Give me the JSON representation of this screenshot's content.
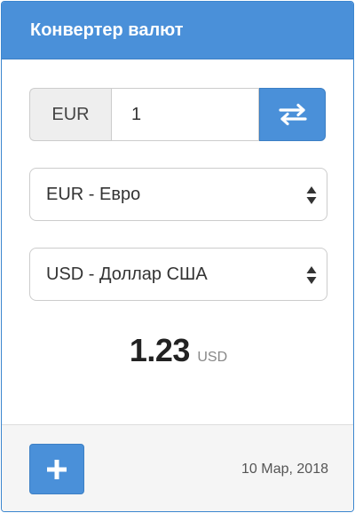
{
  "header": {
    "title": "Конвертер валют"
  },
  "converter": {
    "base_currency_code": "EUR",
    "amount": "1",
    "from_select": {
      "selected": "EUR - Евро"
    },
    "to_select": {
      "selected": "USD - Доллар США"
    }
  },
  "result": {
    "value": "1.23",
    "unit": "USD"
  },
  "footer": {
    "date": "10 Мар, 2018"
  },
  "icons": {
    "swap": "swap-arrows-icon",
    "add": "plus-icon",
    "select_caret": "updown-caret-icon"
  },
  "colors": {
    "accent": "#4a90d9",
    "accent_border": "#3c7fc4",
    "footer_bg": "#f5f5f5",
    "addon_bg": "#eeeeee"
  }
}
